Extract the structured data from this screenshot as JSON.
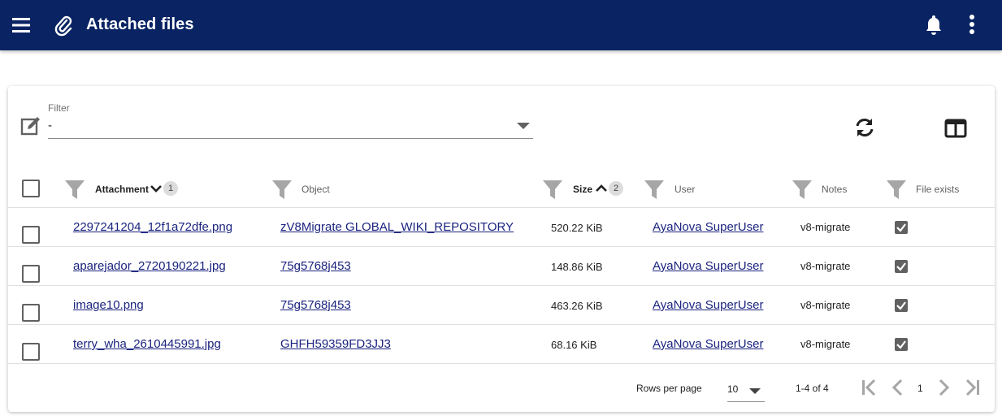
{
  "appbar": {
    "title": "Attached files",
    "icons": {
      "menu": "menu-icon",
      "title": "paperclip-icon",
      "notifications": "bell-icon",
      "more": "more-vertical-icon"
    },
    "color": "#0a2463"
  },
  "filter": {
    "label": "Filter",
    "value": "-",
    "icons": {
      "edit": "edit-note-icon",
      "refresh": "refresh-icon",
      "columns": "view-column-icon"
    }
  },
  "table": {
    "columns": [
      {
        "label": "Attachment",
        "sort": "descending",
        "sort_order": "1"
      },
      {
        "label": "Object"
      },
      {
        "label": "Size",
        "sort": "ascending",
        "sort_order": "2"
      },
      {
        "label": "User"
      },
      {
        "label": "Notes"
      },
      {
        "label": "File exists"
      }
    ],
    "rows": [
      {
        "attachment": "2297241204_12f1a72dfe.png",
        "object": "zV8Migrate GLOBAL_WIKI_REPOSITORY",
        "size": "520.22 KiB",
        "user": "AyaNova SuperUser",
        "notes": "v8-migrate",
        "file_exists": true
      },
      {
        "attachment": "aparejador_2720190221.jpg",
        "object": "75g5768j453",
        "size": "148.86 KiB",
        "user": "AyaNova SuperUser",
        "notes": "v8-migrate",
        "file_exists": true
      },
      {
        "attachment": "image10.png",
        "object": "75g5768j453",
        "size": "463.26 KiB",
        "user": "AyaNova SuperUser",
        "notes": "v8-migrate",
        "file_exists": true
      },
      {
        "attachment": "terry_wha_2610445991.jpg",
        "object": "GHFH59359FD3JJ3",
        "size": "68.16 KiB",
        "user": "AyaNova SuperUser",
        "notes": "v8-migrate",
        "file_exists": true
      }
    ]
  },
  "pagination": {
    "rows_per_page_label": "Rows per page",
    "rows_per_page": "10",
    "range": "1-4 of 4",
    "current_page": "1"
  },
  "colors": {
    "link": "#1a237e",
    "icon": "#616161"
  }
}
